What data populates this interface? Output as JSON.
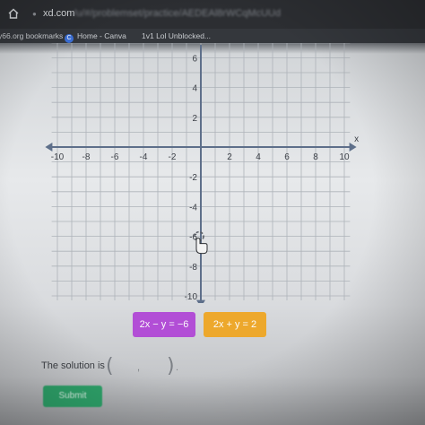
{
  "browser": {
    "url_domain": "xd.com",
    "url_rest": "/u/#/problemset/practice/AEDEAl8rWCqMcUUd",
    "bookmarks": [
      "y66.org bookmarks",
      "Home - Canva",
      "1v1 Lol Unblocked..."
    ],
    "canva_icon_letter": "C"
  },
  "graph": {
    "x_axis_label": "x",
    "x_ticks": [
      "-10",
      "-8",
      "-6",
      "-4",
      "-2",
      "2",
      "4",
      "6",
      "8",
      "10"
    ],
    "y_ticks": [
      "6",
      "4",
      "2",
      "-2",
      "-4",
      "-6",
      "-8",
      "-10"
    ],
    "x_range": [
      -10,
      10
    ],
    "y_range": [
      -10,
      6
    ],
    "point_marker": {
      "x": -0.5,
      "y": -6
    }
  },
  "equations": {
    "first": "2x − y = −6",
    "first_color": "#b043d6",
    "second": "2x + y = 2",
    "second_color": "#f0a51e"
  },
  "solution": {
    "label": "The solution is",
    "open_paren": "(",
    "comma": ",",
    "close_paren": ")",
    "period": ".",
    "x_value": "",
    "y_value": ""
  },
  "submit_label": "Submit",
  "icons": {
    "home": "home-icon",
    "lock": "lock-icon",
    "cursor": "hand-cursor-icon"
  }
}
